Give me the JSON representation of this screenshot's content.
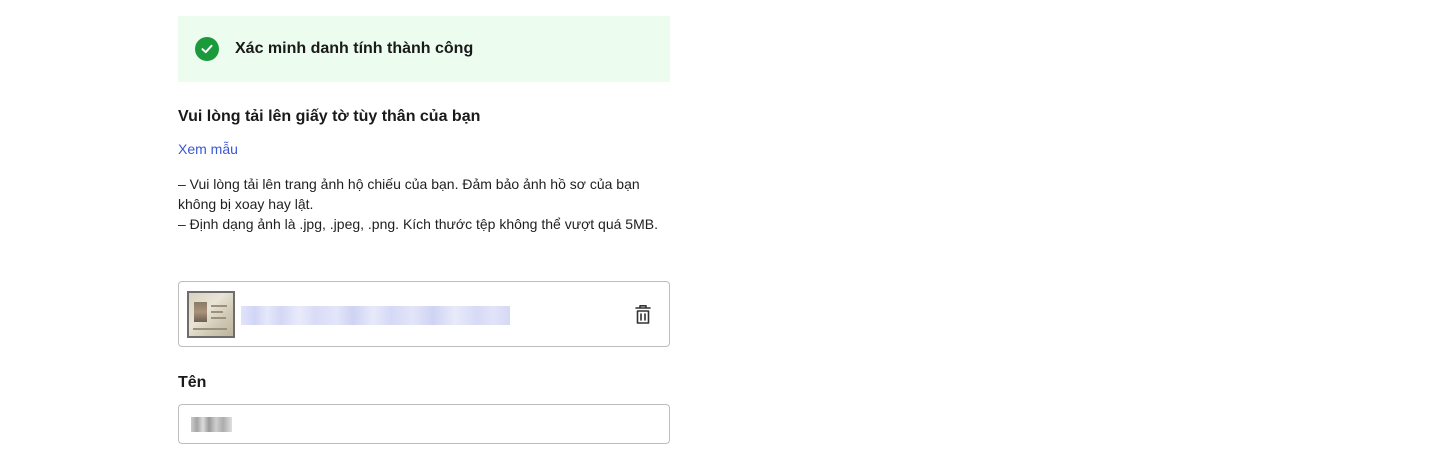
{
  "banner": {
    "icon": "check-circle-icon",
    "text": "Xác minh danh tính thành công",
    "colors": {
      "background": "#ecfcef",
      "icon": "#1b9a3c"
    }
  },
  "upload": {
    "heading": "Vui lòng tải lên giấy tờ tùy thân của bạn",
    "sample_link": "Xem mẫu",
    "instructions": [
      "– Vui lòng tải lên trang ảnh hộ chiếu của bạn. Đảm bảo ảnh hồ sơ của bạn không bị xoay hay lật.",
      "– Định dạng ảnh là .jpg, .jpeg, .png. Kích thước tệp không thể vượt quá 5MB."
    ],
    "file": {
      "thumbnail": "passport-thumbnail",
      "name_blurred": true,
      "delete_icon": "trash-icon"
    }
  },
  "name_field": {
    "label": "Tên",
    "value_blurred": true
  },
  "colors": {
    "link": "#3b57d4",
    "border": "#bdbdbd",
    "text": "#1a1a1a"
  }
}
